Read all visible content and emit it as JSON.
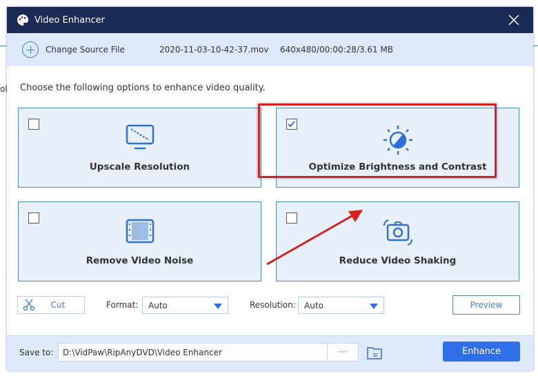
{
  "dialog": {
    "title": "Video Enhancer",
    "close_icon": "close-icon"
  },
  "source": {
    "change_label": "Change Source File",
    "filename": "2020-11-03-10-42-37.mov",
    "meta": "640x480/00:00:28/3.61 MB"
  },
  "prompt": "Choose the following options to enhance video quality.",
  "options": [
    {
      "label": "Upscale Resolution",
      "checked": false,
      "icon": "monitor-icon"
    },
    {
      "label": "Optimize Brightness and Contrast",
      "checked": true,
      "icon": "brightness-icon"
    },
    {
      "label": "Remove Video Noise",
      "checked": false,
      "icon": "film-noise-icon"
    },
    {
      "label": "Reduce Video Shaking",
      "checked": false,
      "icon": "camera-shake-icon"
    }
  ],
  "controls": {
    "cut_label": "Cut",
    "format_label": "Format:",
    "format_value": "Auto",
    "resolution_label": "Resolution:",
    "resolution_value": "Auto",
    "preview_label": "Preview"
  },
  "save": {
    "label": "Save to:",
    "path": "D:\\VidPaw\\RipAnyDVD\\Video Enhancer",
    "browse_label": "···",
    "enhance_label": "Enhance"
  },
  "colors": {
    "titlebar": "#1b2a55",
    "accent": "#2f6fe8",
    "annotation": "#d92020"
  }
}
